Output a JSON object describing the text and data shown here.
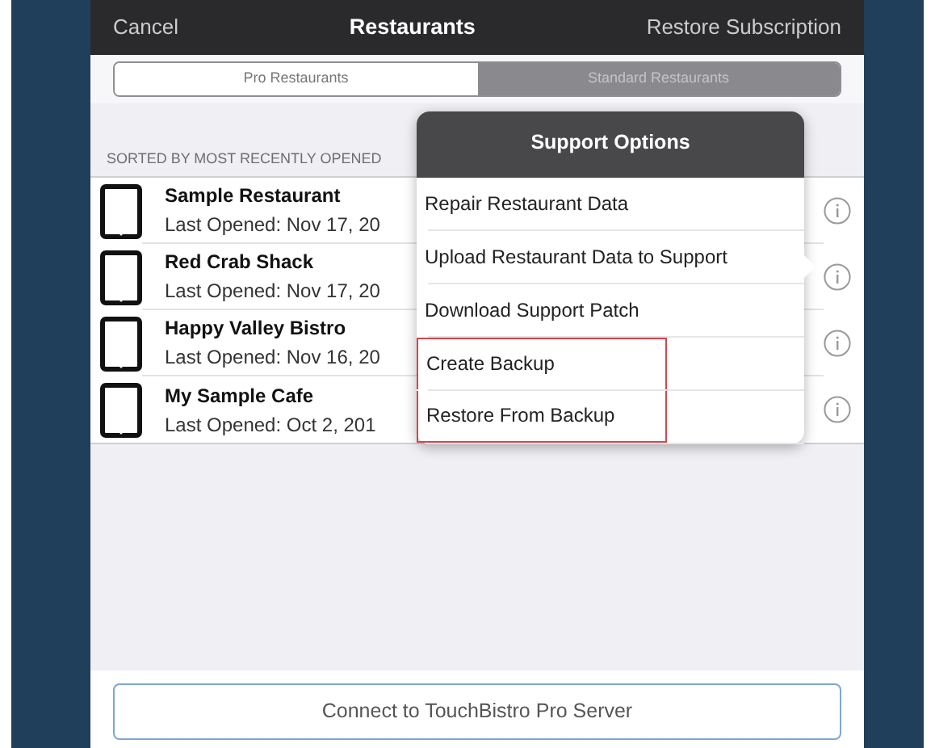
{
  "navbar": {
    "left": "Cancel",
    "title": "Restaurants",
    "right": "Restore Subscription"
  },
  "segments": [
    {
      "label": "Pro Restaurants",
      "selected": true
    },
    {
      "label": "Standard Restaurants",
      "selected": false
    }
  ],
  "section_header": "SORTED BY MOST RECENTLY OPENED",
  "restaurants": [
    {
      "name": "Sample Restaurant",
      "last_opened": "Last Opened: Nov 17, 20"
    },
    {
      "name": "Red Crab Shack",
      "last_opened": "Last Opened: Nov 17, 20"
    },
    {
      "name": "Happy Valley Bistro",
      "last_opened": "Last Opened: Nov 16, 20"
    },
    {
      "name": "My Sample Cafe",
      "last_opened": "Last Opened: Oct 2, 201"
    }
  ],
  "popover": {
    "title": "Support Options",
    "options": [
      {
        "label": "Repair Restaurant Data",
        "highlighted": false
      },
      {
        "label": "Upload Restaurant Data to Support",
        "highlighted": false
      },
      {
        "label": "Download Support Patch",
        "highlighted": false
      },
      {
        "label": "Create Backup",
        "highlighted": true
      },
      {
        "label": "Restore From Backup",
        "highlighted": true
      }
    ]
  },
  "footer_button": "Connect to TouchBistro Pro Server"
}
